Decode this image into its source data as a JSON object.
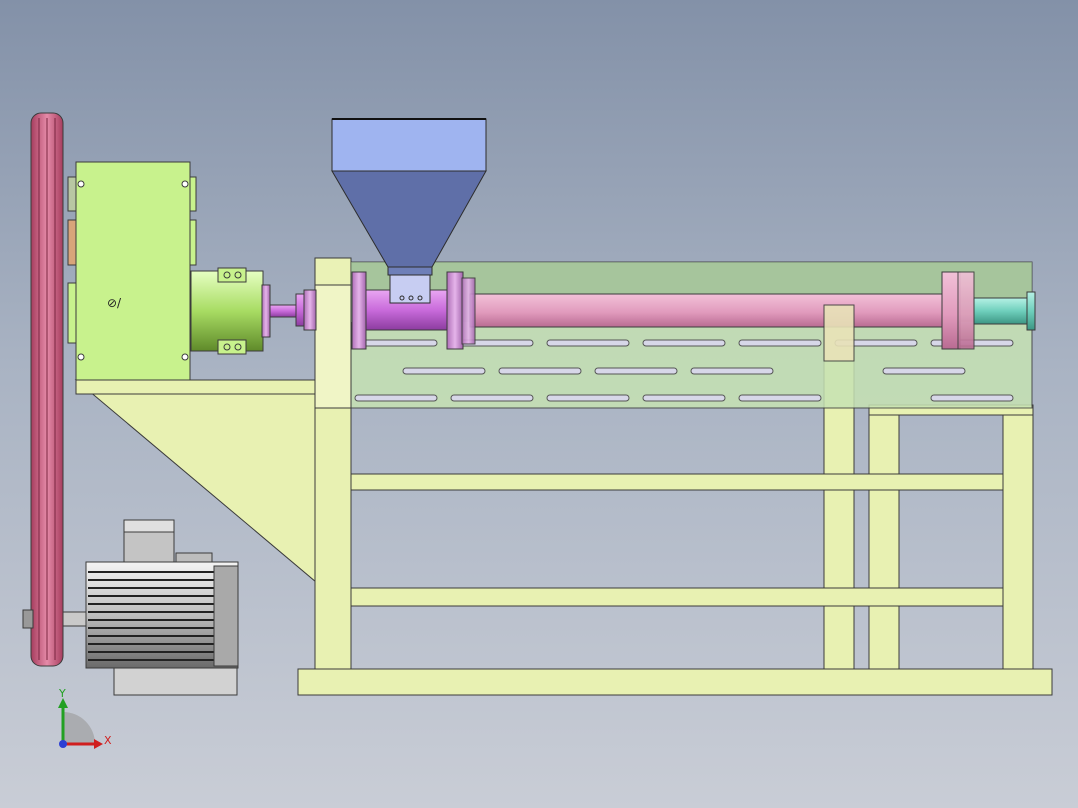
{
  "gearbox": {
    "marking": "⊘/"
  },
  "triad": {
    "x_label": "X",
    "y_label": "Y"
  },
  "colors": {
    "frame": "#e8f1b2",
    "gearbox": "#c8f28d",
    "hopper": "#9fb4f0",
    "hopper_dark": "#5f6fa8",
    "barrel": "#e6a3c4",
    "flange": "#c58ac8",
    "screw_head": "#cc77dd",
    "pulley": "#c9587a",
    "motor": "#c8c8c8",
    "cover": "#c6e2b3",
    "cover_top": "#8fb488",
    "coupling": "#b2e36a",
    "end_fitting": "#7fd3c3"
  }
}
